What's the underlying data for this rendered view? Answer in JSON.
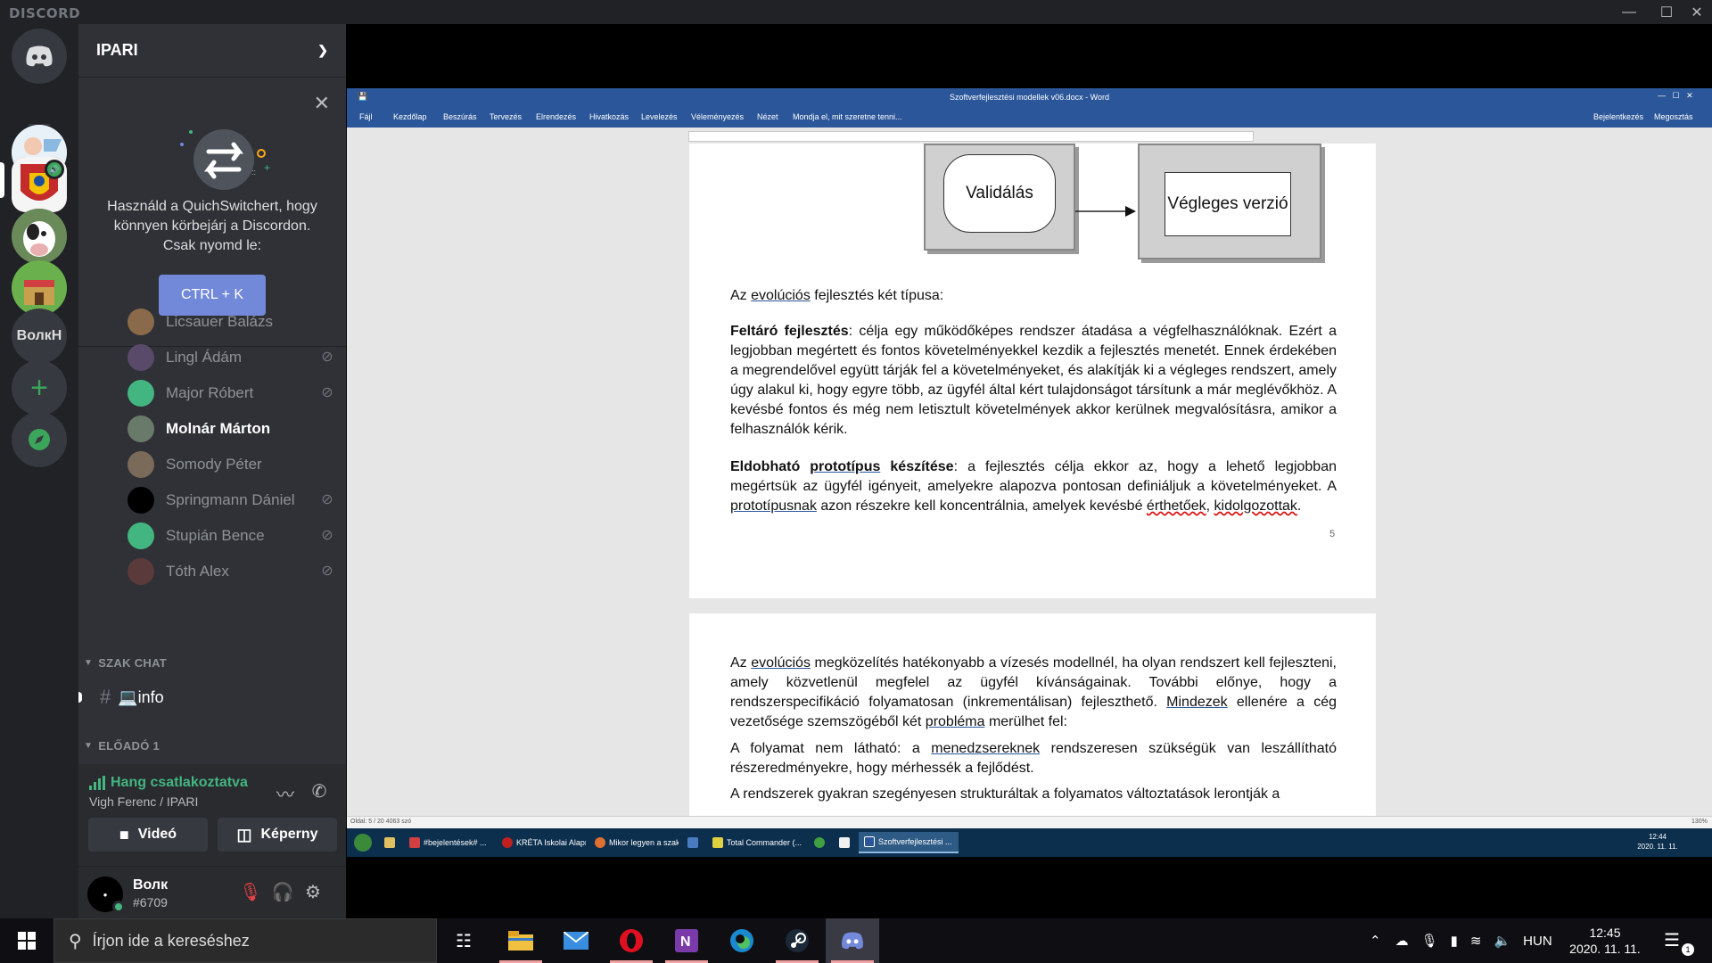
{
  "window": {
    "brand": "DISCORD"
  },
  "rail": {
    "text_server": "ВолкН"
  },
  "server": {
    "name": "IPARI"
  },
  "quickswitcher": {
    "text": "Használd a QuichSwitchert, hogy könnyen körbejárj a Discordon. Csak nyomd le:",
    "button": "CTRL + K"
  },
  "members": [
    {
      "name": "Licsauer Balázs",
      "muted": false,
      "active": false,
      "avatar_color": "#8a6a4a"
    },
    {
      "name": "Lingl Ádám",
      "muted": true,
      "active": false,
      "avatar_color": "#5a4a6a"
    },
    {
      "name": "Major Róbert",
      "muted": true,
      "active": false,
      "avatar_color": "#43b581"
    },
    {
      "name": "Molnár Márton",
      "muted": false,
      "active": true,
      "avatar_color": "#6a7a6a"
    },
    {
      "name": "Somody Péter",
      "muted": false,
      "active": false,
      "avatar_color": "#7a6a5a"
    },
    {
      "name": "Springmann Dániel",
      "muted": true,
      "active": false,
      "avatar_color": "#000000"
    },
    {
      "name": "Stupián Bence",
      "muted": true,
      "active": false,
      "avatar_color": "#43b581"
    },
    {
      "name": "Tóth Alex",
      "muted": true,
      "active": false,
      "avatar_color": "#5a3a3a"
    }
  ],
  "categories": {
    "szak_chat": "SZAK CHAT",
    "eloado": "ELŐADÓ 1"
  },
  "channel": {
    "name": "💻info"
  },
  "voice": {
    "status": "Hang csatlakoztatva",
    "location": "Vigh Ferenc / IPARI",
    "video_button": "Videó",
    "screen_button": "Képerny"
  },
  "user": {
    "name": "Волк",
    "tag": "#6709"
  },
  "word": {
    "title": "Szoftverfejlesztési modellek v06.docx - Word",
    "tabs": [
      "Fájl",
      "Kezdőlap",
      "Beszúrás",
      "Tervezés",
      "Elrendezés",
      "Hivatkozás",
      "Levelezés",
      "Véleményezés",
      "Nézet",
      "Mondja el, mit szeretne tenni..."
    ],
    "right_links": [
      "Bejelentkezés",
      "Megosztás"
    ],
    "diagram": {
      "left": "Validálás",
      "right": "Végleges verzió"
    },
    "page_number": "5",
    "status_left": "Oldal: 5 / 20     4063 szó",
    "status_right": "130%",
    "taskbar": [
      "#bejelentések# ...",
      "KRÉTA Iskolai Alapr...",
      "Mikor legyen a szak...",
      "Total Commander (...",
      "Szoftverfejlesztési ..."
    ],
    "tray_time": "12:44",
    "tray_date": "2020. 11. 11."
  },
  "taskbar": {
    "search_placeholder": "Írjon ide a kereséshez",
    "language": "HUN",
    "time": "12:45",
    "date": "2020. 11. 11.",
    "notifications": "1"
  }
}
